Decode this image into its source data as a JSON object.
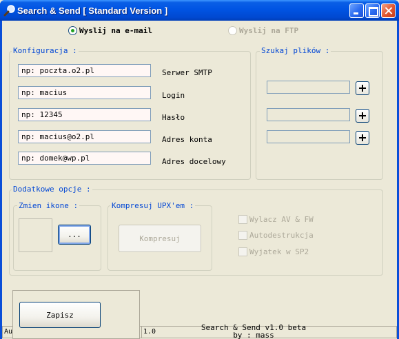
{
  "window": {
    "title": "Search & Send [ Standard Version ]"
  },
  "send_mode": {
    "email_label": "Wyslij na e-mail",
    "ftp_label": "Wyslij na FTP"
  },
  "config": {
    "title": "Konfiguracja :",
    "fields": [
      {
        "value": "np: poczta.o2.pl",
        "label": "Serwer SMTP"
      },
      {
        "value": "np: macius",
        "label": "Login"
      },
      {
        "value": "np: 12345",
        "label": "Hasło"
      },
      {
        "value": "np: macius@o2.pl",
        "label": "Adres konta"
      },
      {
        "value": "np: domek@wp.pl",
        "label": "Adres docelowy"
      }
    ]
  },
  "search": {
    "title": "Szukaj plików :"
  },
  "extra": {
    "title": "Dodatkowe opcje :",
    "icon_group": {
      "title": "Zmien ikone :",
      "browse_label": "..."
    },
    "upx_group": {
      "title": "Kompresuj UPX'em :",
      "compress_label": "Kompresuj"
    },
    "options": [
      "Wylacz AV & FW",
      "Autodestrukcja",
      "Wyjatek w SP2"
    ]
  },
  "save_label": "Zapisz",
  "statusbar": {
    "seg1": "Au",
    "seg2": "1.0"
  },
  "footer": {
    "line1": "Search & Send v1.0 beta",
    "line2": "by : mass"
  }
}
